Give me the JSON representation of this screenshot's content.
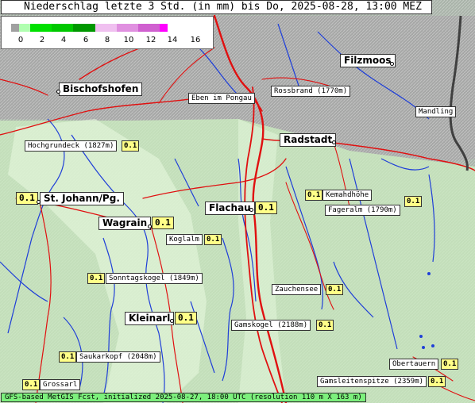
{
  "title": "Niederschlag letzte 3 Std. (in mm) bis Do, 2025-08-28, 13:00 MEZ",
  "legend": {
    "ticks": [
      "0",
      "2",
      "4",
      "6",
      "8",
      "10",
      "12",
      "14",
      "16"
    ],
    "colors": [
      "#a0a0a0",
      "#b0ffb0",
      "#00e000",
      "#00b000",
      "#008800",
      "#e8b0e8",
      "#e080e0",
      "#d050d0",
      "#ff00ff"
    ]
  },
  "colors": {
    "mountain": "#b8c2b8",
    "valley": "#d6f0c8",
    "snow_area": "#c8c8c8",
    "river": "#1f3fd8",
    "road": "#e01010",
    "border": "#404040"
  },
  "places": {
    "bischofshofen": "Bischofshofen",
    "filzmoos": "Filzmoos",
    "eben": "Eben im Pongau",
    "rossbrand": "Rossbrand (1770m)",
    "mandling": "Mandling",
    "radstadt": "Radstadt",
    "hochgrundeck": "Hochgrundeck (1827m)",
    "st_johann": "St. Johann/Pg.",
    "kemahdhoehe": "Kemahdhöhe",
    "fageralm": "Fageralm (1790m)",
    "flachau": "Flachau",
    "wagrain": "Wagrain",
    "koglalm": "Koglalm",
    "sonntagskogel": "Sonntagskogel (1849m)",
    "zauchensee": "Zauchensee",
    "kleinarl": "Kleinarl",
    "gamskogel": "Gamskogel (2188m)",
    "saukarkopf": "Saukarkopf (2048m)",
    "obertauern": "Obertauern",
    "grossarl": "Grossarl",
    "gamsleitenspitze": "Gamsleitenspitze (2359m)"
  },
  "values": {
    "hochgrundeck": "0.1",
    "st_johann": "0.1",
    "kemahdhoehe": "0.1",
    "fageralm": "0.1",
    "flachau": "0.1",
    "wagrain": "0.1",
    "koglalm": "0.1",
    "sonntagskogel": "0.1",
    "zauchensee": "0.1",
    "kleinarl": "0.1",
    "gamskogel": "0.1",
    "saukarkopf": "0.1",
    "obertauern": "0.1",
    "grossarl": "0.1",
    "gamsleitenspitze": "0.1"
  },
  "footer": "GFS-based MetGIS Fcst, initialized 2025-08-27, 18:00 UTC  (resolution 110 m X 163 m)"
}
